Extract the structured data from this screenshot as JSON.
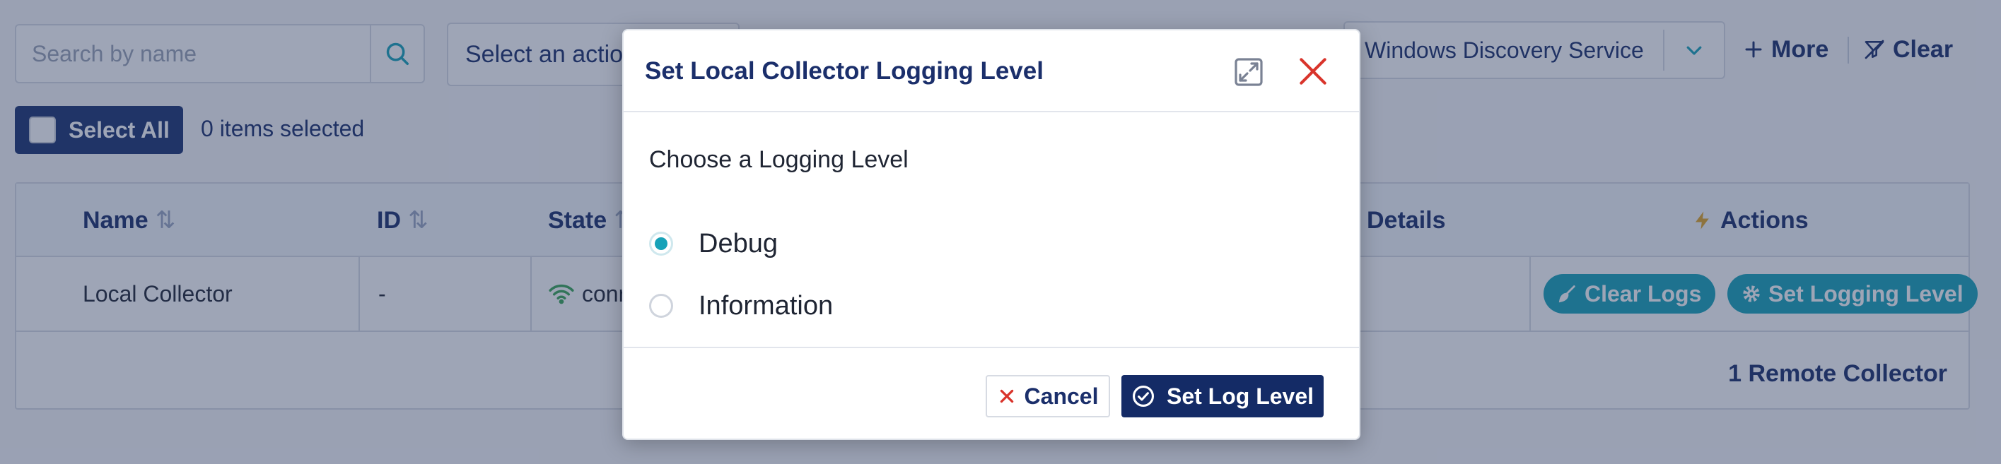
{
  "toolbar": {
    "search_placeholder": "Search by name",
    "action_select": "Select an action",
    "filter_value": "Windows Discovery Service",
    "more_label": "More",
    "clear_label": "Clear"
  },
  "selection": {
    "select_all_label": "Select All",
    "items_selected": "0 items selected"
  },
  "table": {
    "columns": [
      "Name",
      "ID",
      "State",
      "Details",
      "Actions"
    ],
    "rows": [
      {
        "name": "Local Collector",
        "id": "-",
        "state": "connected",
        "details": "",
        "actions": [
          "Clear Logs",
          "Set Logging Level"
        ]
      }
    ],
    "footer_count": "1 Remote Collector"
  },
  "modal": {
    "title": "Set Local Collector Logging Level",
    "body_label": "Choose a Logging Level",
    "options": [
      {
        "label": "Debug",
        "checked": true
      },
      {
        "label": "Information",
        "checked": false
      }
    ],
    "cancel_label": "Cancel",
    "submit_label": "Set Log Level"
  },
  "colors": {
    "primary": "#142b66",
    "accent": "#17a2b8",
    "danger": "#d9342b",
    "connected": "#3aa757",
    "actions_icon": "#e0a526"
  },
  "icons": {
    "search": "search-icon",
    "chevron": "chevron-down-icon",
    "more": "plus-icon",
    "clear": "filter-clear-icon",
    "state": "wifi-icon",
    "actions": "lightning-icon",
    "clear_logs": "broom-icon",
    "set_logging": "gear-icon",
    "expand": "expand-icon",
    "close": "close-icon",
    "submit": "check-circle-icon"
  }
}
